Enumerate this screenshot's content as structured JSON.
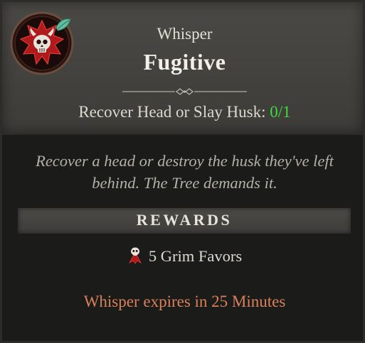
{
  "quest": {
    "category": "Whisper",
    "title": "Fugitive",
    "objective_label": "Recover Head or Slay Husk:",
    "objective_progress": "0/1",
    "description": "Recover a head or destroy the husk they've left behind. The Tree demands it."
  },
  "rewards": {
    "heading": "REWARDS",
    "items": [
      {
        "icon": "grim-favor-icon",
        "label": "5 Grim Favors"
      }
    ]
  },
  "expiry_text": "Whisper expires in 25 Minutes",
  "icons": {
    "emblem": "whisper-skull-emblem-icon",
    "divider": "ornamental-divider-icon"
  },
  "colors": {
    "progress": "#3fdc3c",
    "expiry": "#d9825a",
    "emblem_red": "#b01a1c",
    "leaf_teal": "#5fbfa0"
  }
}
